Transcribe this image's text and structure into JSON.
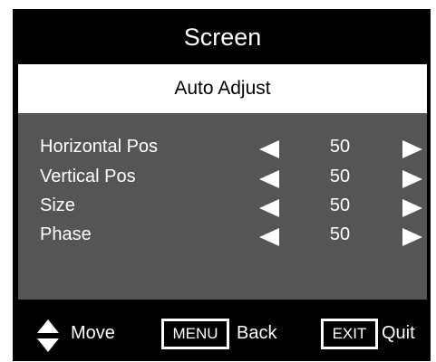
{
  "title": "Screen",
  "auto_adjust": "Auto Adjust",
  "settings": [
    {
      "label": "Horizontal Pos",
      "value": "50"
    },
    {
      "label": "Vertical Pos",
      "value": "50"
    },
    {
      "label": "Size",
      "value": "50"
    },
    {
      "label": "Phase",
      "value": "50"
    }
  ],
  "footer": {
    "move_label": "Move",
    "menu_key": "MENU",
    "back_label": "Back",
    "exit_key": "EXIT",
    "quit_label": "Quit"
  },
  "colors": {
    "background": "#000000",
    "panel": "#555555",
    "highlight": "#ffffff",
    "text": "#ffffff"
  }
}
